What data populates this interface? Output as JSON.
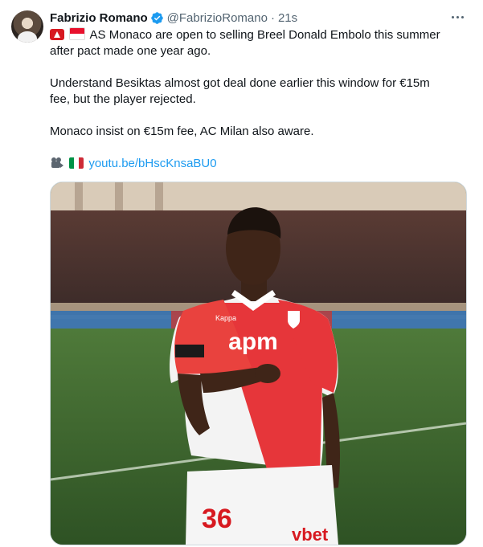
{
  "tweet": {
    "author_name": "Fabrizio Romano",
    "handle": "@FabrizioRomano",
    "separator": "·",
    "time": "21s",
    "lines": [
      "AS Monaco are open to selling Breel Donald Embolo this summer",
      "after pact made one year ago.",
      "Understand Besiktas almost got deal done earlier this window for €15m",
      "fee, but the player rejected.",
      "Monaco insist on €15m fee, AC Milan also aware."
    ],
    "link_text": "youtu.be/bHscKnsaBU0"
  },
  "photo": {
    "shirt_number": "36",
    "sponsor": "apm",
    "kit_brand": "Kappa",
    "sleeve_sponsor": "vbet"
  },
  "icons": {
    "verified": "verified-badge-icon",
    "more": "more-options-icon",
    "flags": [
      "monaco-crest-flag-icon",
      "monaco-flag-icon",
      "video-camera-icon",
      "italy-flag-icon"
    ]
  },
  "colors": {
    "accent": "#1d9bf0",
    "text": "#0f1419",
    "secondary": "#536471",
    "monaco_red": "#e8112d"
  }
}
